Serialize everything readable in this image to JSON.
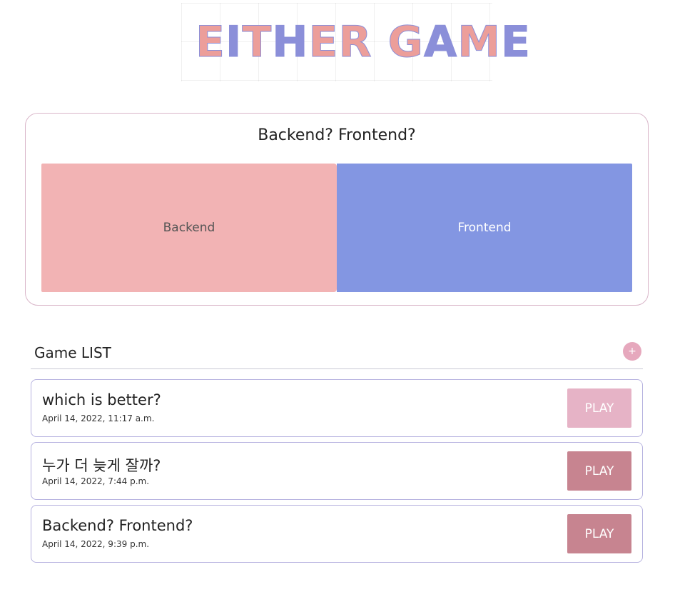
{
  "logo": {
    "parts": [
      "E",
      "I",
      "T",
      "H",
      "E",
      "R",
      " ",
      "G",
      "A",
      "M",
      "E"
    ],
    "colors": [
      "#ec9e9a",
      "#8b8fd9",
      "#ec9e9a",
      "#8b8fd9",
      "#ec9e9a",
      "#ec9e9a",
      "",
      "#ec9e9a",
      "#8b8fd9",
      "#ec9e9a",
      "#8b8fd9"
    ]
  },
  "feature": {
    "title": "Backend? Frontend?",
    "option_a": "Backend",
    "option_b": "Frontend"
  },
  "list": {
    "title": "Game LIST",
    "add_label": "+"
  },
  "games": [
    {
      "name": "which is better?",
      "date": "April 14, 2022, 11:17 a.m.",
      "play_label": "PLAY",
      "play_color": "#e6b3c6"
    },
    {
      "name": "누가 더 늦게 잘까?",
      "date": "April 14, 2022, 7:44 p.m.",
      "play_label": "PLAY",
      "play_color": "#c78490"
    },
    {
      "name": "Backend? Frontend?",
      "date": "April 14, 2022, 9:39 p.m.",
      "play_label": "PLAY",
      "play_color": "#c78490"
    }
  ],
  "colors": {
    "accent_pink": "#f2b3b4",
    "accent_blue": "#8396e2"
  }
}
